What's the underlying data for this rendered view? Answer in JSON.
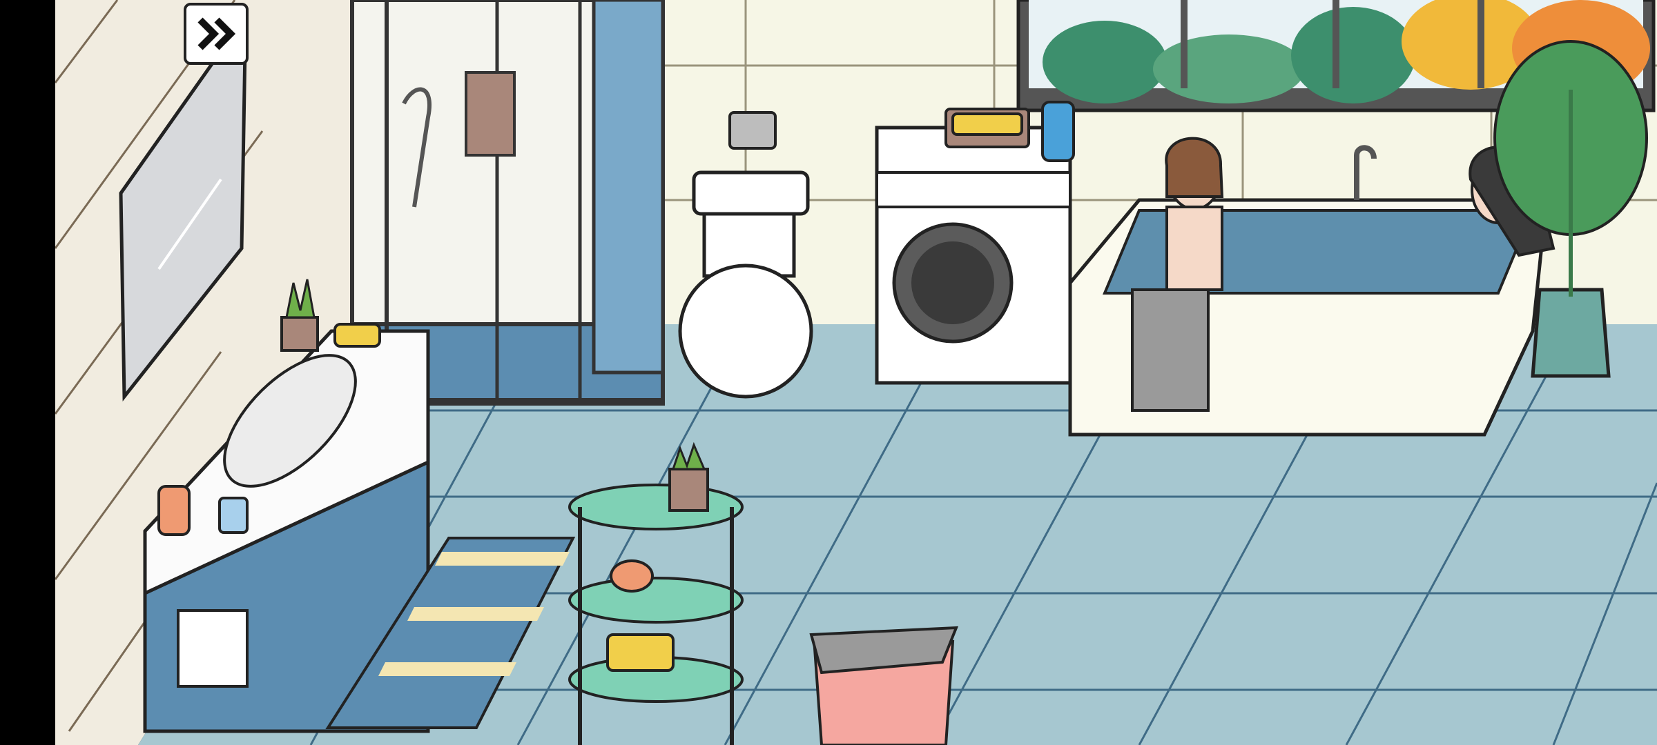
{
  "screen": {
    "scene_name": "",
    "skip_button": {
      "label": "",
      "icon": "fast-forward-icon"
    }
  },
  "colors": {
    "wall": "#f6f6e6",
    "tile_floor": "#a6c7d0",
    "floor_lines": "#3f6b86",
    "outline": "#222222",
    "cabinet_blue": "#5c8db1",
    "shelf_green": "#7fd1b5",
    "towel_gray": "#9a9a9a",
    "towel_brown": "#a9877a",
    "sponge_yellow": "#f1cf4a",
    "basket_pink": "#f5a7a0",
    "forest_green": "#3d8f6d",
    "autumn_orange": "#ee8e3a"
  }
}
